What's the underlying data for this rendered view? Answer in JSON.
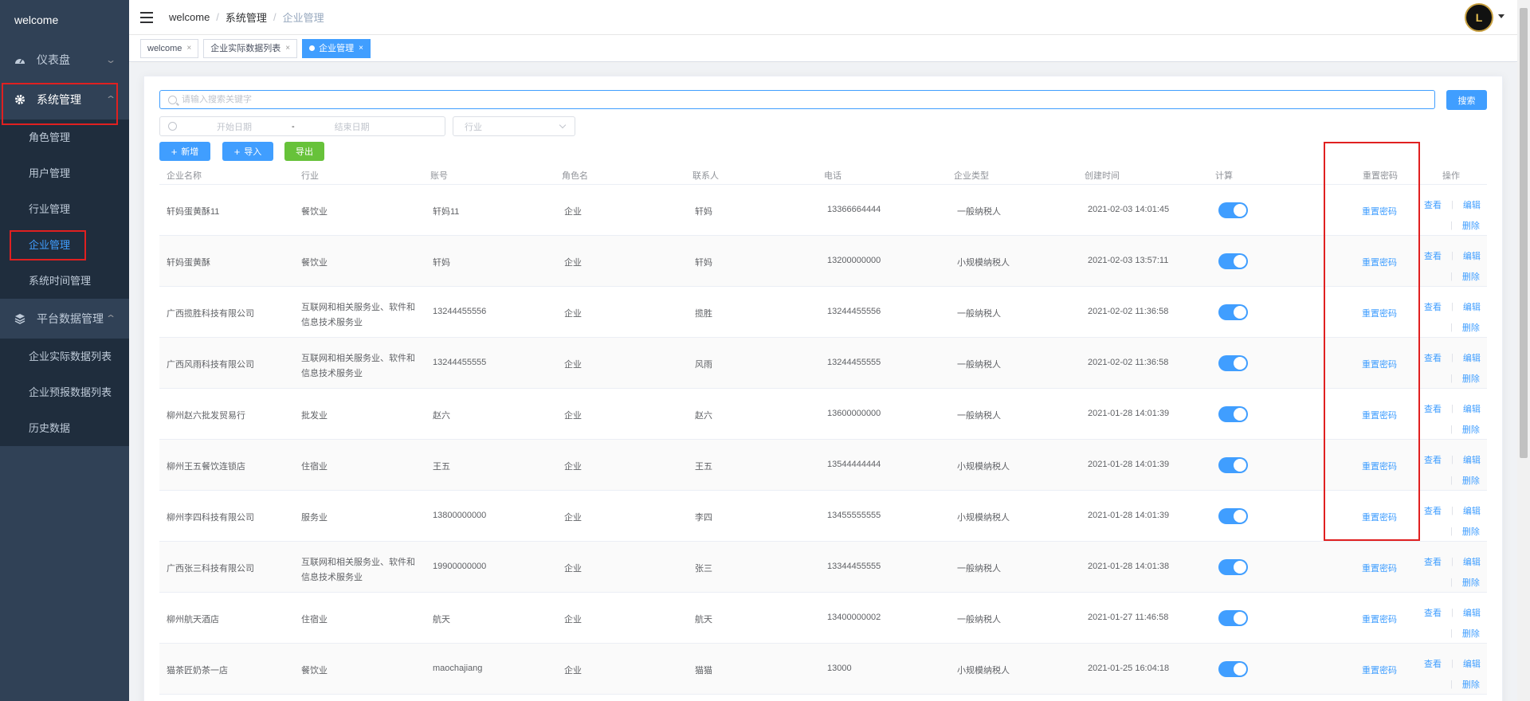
{
  "sidebar": {
    "logo": "welcome",
    "menus": [
      {
        "label": "仪表盘"
      },
      {
        "label": "系统管理",
        "children": [
          "角色管理",
          "用户管理",
          "行业管理",
          "企业管理",
          "系统时间管理"
        ]
      },
      {
        "label": "平台数据管理",
        "children": [
          "企业实际数据列表",
          "企业预报数据列表",
          "历史数据"
        ]
      }
    ]
  },
  "navbar": {
    "breadcrumb": [
      "welcome",
      "系统管理",
      "企业管理"
    ],
    "avatar_text": "L"
  },
  "tags": [
    "welcome",
    "企业实际数据列表",
    "企业管理"
  ],
  "search": {
    "placeholder": "请输入搜索关键字",
    "button": "搜索",
    "start_placeholder": "开始日期",
    "range_sep": "-",
    "end_placeholder": "结束日期",
    "industry_placeholder": "行业"
  },
  "toolbar": {
    "add": "新增",
    "import": "导入",
    "export": "导出"
  },
  "table": {
    "columns": [
      "企业名称",
      "行业",
      "账号",
      "角色名",
      "联系人",
      "电话",
      "企业类型",
      "创建时间",
      "计算",
      "重置密码",
      "操作"
    ],
    "actions": {
      "view": "查看",
      "edit": "编辑",
      "delete": "删除",
      "reset": "重置密码",
      "sep": "|"
    },
    "rows": [
      {
        "name": "轩妈蛋黄酥11",
        "industry": "餐饮业",
        "account": "轩妈11",
        "role": "企业",
        "contact": "轩妈",
        "phone": "13366664444",
        "type": "一般纳税人",
        "created": "2021-02-03 14:01:45",
        "calc": true
      },
      {
        "name": "轩妈蛋黄酥",
        "industry": "餐饮业",
        "account": "轩妈",
        "role": "企业",
        "contact": "轩妈",
        "phone": "13200000000",
        "type": "小规模纳税人",
        "created": "2021-02-03 13:57:11",
        "calc": true
      },
      {
        "name": "广西揽胜科技有限公司",
        "industry": "互联网和相关服务业、软件和信息技术服务业",
        "account": "13244455556",
        "role": "企业",
        "contact": "揽胜",
        "phone": "13244455556",
        "type": "一般纳税人",
        "created": "2021-02-02 11:36:58",
        "calc": true
      },
      {
        "name": "广西风雨科技有限公司",
        "industry": "互联网和相关服务业、软件和信息技术服务业",
        "account": "13244455555",
        "role": "企业",
        "contact": "风雨",
        "phone": "13244455555",
        "type": "一般纳税人",
        "created": "2021-02-02 11:36:58",
        "calc": true
      },
      {
        "name": "柳州赵六批发贸易行",
        "industry": "批发业",
        "account": "赵六",
        "role": "企业",
        "contact": "赵六",
        "phone": "13600000000",
        "type": "一般纳税人",
        "created": "2021-01-28 14:01:39",
        "calc": true
      },
      {
        "name": "柳州王五餐饮连锁店",
        "industry": "住宿业",
        "account": "王五",
        "role": "企业",
        "contact": "王五",
        "phone": "13544444444",
        "type": "小规模纳税人",
        "created": "2021-01-28 14:01:39",
        "calc": true
      },
      {
        "name": "柳州李四科技有限公司",
        "industry": "服务业",
        "account": "13800000000",
        "role": "企业",
        "contact": "李四",
        "phone": "13455555555",
        "type": "小规模纳税人",
        "created": "2021-01-28 14:01:39",
        "calc": true
      },
      {
        "name": "广西张三科技有限公司",
        "industry": "互联网和相关服务业、软件和信息技术服务业",
        "account": "19900000000",
        "role": "企业",
        "contact": "张三",
        "phone": "13344455555",
        "type": "一般纳税人",
        "created": "2021-01-28 14:01:38",
        "calc": true
      },
      {
        "name": "柳州航天酒店",
        "industry": "住宿业",
        "account": "航天",
        "role": "企业",
        "contact": "航天",
        "phone": "13400000002",
        "type": "一般纳税人",
        "created": "2021-01-27 11:46:58",
        "calc": true
      },
      {
        "name": "猫茶匠奶茶一店",
        "industry": "餐饮业",
        "account": "maochajiang",
        "role": "企业",
        "contact": "猫猫",
        "phone": "13000",
        "type": "小规模纳税人",
        "created": "2021-01-25 16:04:18",
        "calc": true
      }
    ]
  },
  "colors": {
    "sidebar_bg": "#304156",
    "submenu_bg": "#1f2d3d",
    "primary": "#409eff",
    "success": "#67c23a",
    "highlight": "#e02020"
  }
}
